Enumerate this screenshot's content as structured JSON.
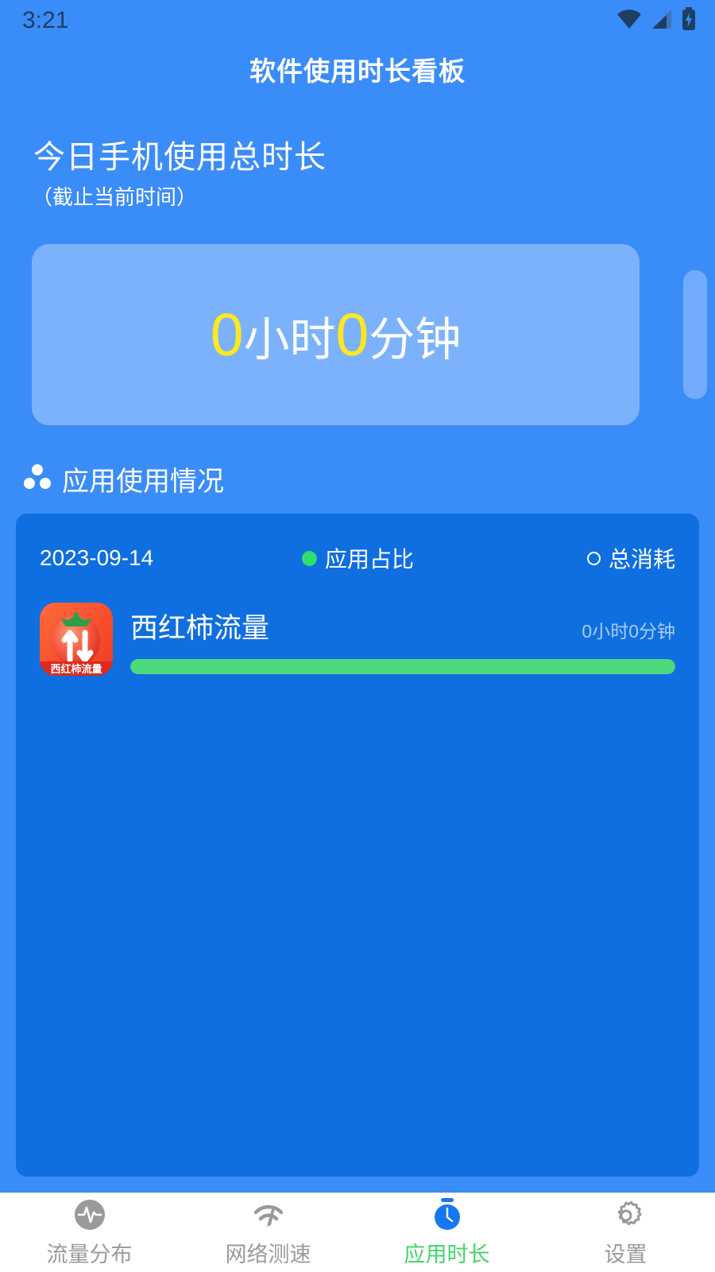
{
  "status_bar": {
    "time": "3:21",
    "icons": [
      "wifi-icon",
      "signal-icon",
      "battery-charging-icon"
    ]
  },
  "header": {
    "title": "软件使用时长看板"
  },
  "total_usage": {
    "heading": "今日手机使用总时长",
    "subheading": "（截止当前时间）",
    "hours_value": "0",
    "hours_unit": "小时",
    "minutes_value": "0",
    "minutes_unit": "分钟",
    "number_color": "#ffe81f",
    "card_color": "#7cb2fb"
  },
  "usage_section": {
    "icon": "three-circles-icon",
    "label": "应用使用情况",
    "date": "2023-09-14",
    "legend": [
      {
        "label": "应用占比",
        "marker": "filled-dot",
        "color": "#30dd6e"
      },
      {
        "label": "总消耗",
        "marker": "hollow-circle",
        "color": "#ffffff"
      }
    ],
    "apps": [
      {
        "icon": "tomato-traffic-app-icon",
        "icon_label": "西红柿流量",
        "name": "西红柿流量",
        "duration": "0小时0分钟",
        "percent": 100,
        "bar_color": "#4cd97b"
      }
    ]
  },
  "bottom_nav": {
    "items": [
      {
        "label": "流量分布",
        "icon": "pulse-circle-icon",
        "active": false
      },
      {
        "label": "网络测速",
        "icon": "speed-test-icon",
        "active": false
      },
      {
        "label": "应用时长",
        "icon": "stopwatch-icon",
        "active": true
      },
      {
        "label": "设置",
        "icon": "gear-icon",
        "active": false
      }
    ],
    "active_color": "#44d46a",
    "inactive_color": "#9a9a9a"
  }
}
